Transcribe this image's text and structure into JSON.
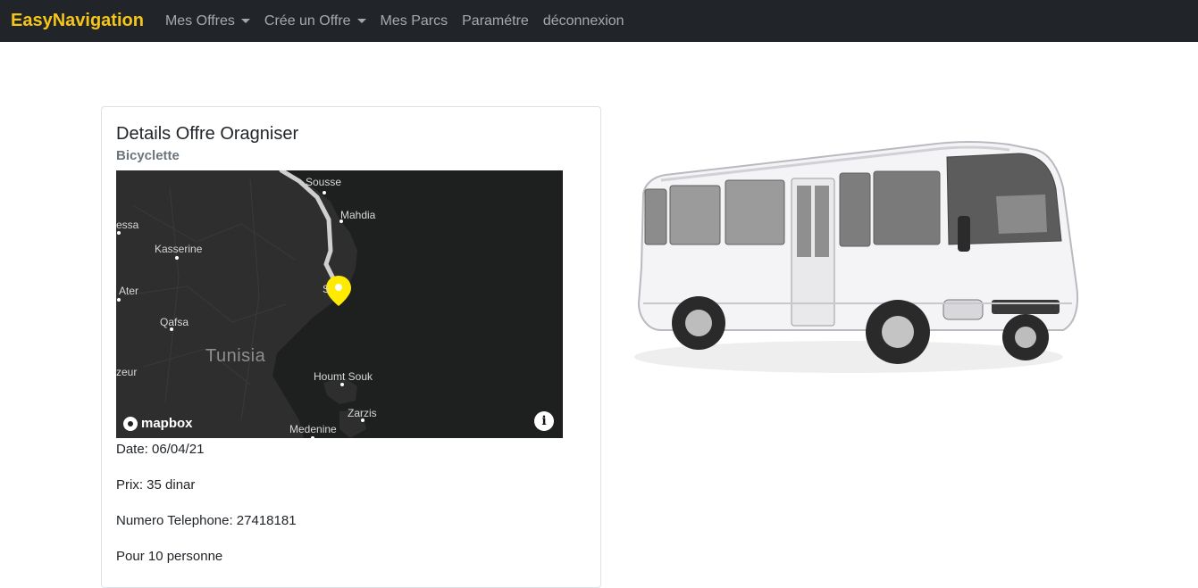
{
  "navbar": {
    "brand": "EasyNavigation",
    "items": [
      {
        "label": "Mes Offres",
        "dropdown": true
      },
      {
        "label": "Crée un Offre",
        "dropdown": true
      },
      {
        "label": "Mes Parcs",
        "dropdown": false
      },
      {
        "label": "Paramétre",
        "dropdown": false
      },
      {
        "label": "déconnexion",
        "dropdown": false
      }
    ]
  },
  "card": {
    "title": "Details Offre Oragniser",
    "subtitle": "Bicyclette",
    "map": {
      "labels": {
        "sousse": "Sousse",
        "mahdia": "Mahdia",
        "essa": "essa",
        "kasserine": "Kasserine",
        "ater": "Ater",
        "sfax_partial": "S",
        "qafsa": "Qafsa",
        "tunisia": "Tunisia",
        "zeur": "zeur",
        "houmt_souk": "Houmt Souk",
        "zarzis": "Zarzis",
        "medenine": "Medenine"
      },
      "attribution": "mapbox",
      "info_glyph": "i",
      "marker_color": "#ffeb00"
    },
    "details": {
      "date": "Date: 06/04/21",
      "prix": "Prix: 35 dinar",
      "telephone": "Numero Telephone: 27418181",
      "personnes": "Pour 10 personne"
    }
  },
  "colors": {
    "navbar_bg": "#212529",
    "brand": "#f5c518",
    "nav_link": "rgba(255,255,255,0.6)"
  }
}
